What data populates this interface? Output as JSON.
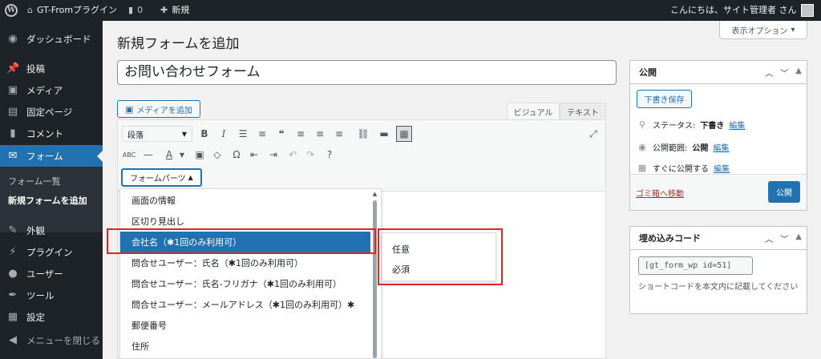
{
  "adminbar": {
    "site_name": "GT-Fromプラグイン",
    "comments_count": "0",
    "new_label": "新規",
    "greeting": "こんにちは、サイト管理者 さん"
  },
  "sidebar": {
    "items": [
      {
        "label": "ダッシュボード",
        "icon": "dashboard-icon",
        "glyph": "◉"
      },
      {
        "label": "投稿",
        "icon": "pin-icon",
        "glyph": "📌"
      },
      {
        "label": "メディア",
        "icon": "media-icon",
        "glyph": "▣"
      },
      {
        "label": "固定ページ",
        "icon": "page-icon",
        "glyph": "▤"
      },
      {
        "label": "コメント",
        "icon": "comment-icon",
        "glyph": "▮"
      },
      {
        "label": "フォーム",
        "icon": "mail-icon",
        "glyph": "✉"
      }
    ],
    "submenu": [
      "フォーム一覧",
      "新規フォームを追加"
    ],
    "items_lower": [
      {
        "label": "外観",
        "icon": "brush-icon",
        "glyph": "✎"
      },
      {
        "label": "プラグイン",
        "icon": "plugin-icon",
        "glyph": "⚡"
      },
      {
        "label": "ユーザー",
        "icon": "user-icon",
        "glyph": "●"
      },
      {
        "label": "ツール",
        "icon": "wrench-icon",
        "glyph": "✒"
      },
      {
        "label": "設定",
        "icon": "settings-icon",
        "glyph": "▦"
      },
      {
        "label": "メニューを閉じる",
        "icon": "collapse-icon",
        "glyph": "◀"
      }
    ]
  },
  "main": {
    "page_title": "新規フォームを追加",
    "screen_options": "表示オプション",
    "title_value": "お問い合わせフォーム",
    "add_media": "メディアを追加",
    "tabs": [
      "ビジュアル",
      "テキスト"
    ]
  },
  "toolbar": {
    "format_select": "段落",
    "form_parts": "フォームパーツ"
  },
  "dropdown": {
    "items": [
      "画面の情報",
      "区切り見出し",
      "会社名（✱1回のみ利用可）",
      "問合せユーザー：氏名（✱1回のみ利用可）",
      "問合せユーザー：氏名-フリガナ（✱1回のみ利用可）",
      "問合せユーザー：メールアドレス（✱1回のみ利用可）✱",
      "郵便番号",
      "住所"
    ],
    "submenu": [
      "任意",
      "必須"
    ]
  },
  "publish_box": {
    "title": "公開",
    "save_draft": "下書き保存",
    "status_label": "ステータス:",
    "status_value": "下書き",
    "visibility_label": "公開範囲:",
    "visibility_value": "公開",
    "schedule": "すぐに公開する",
    "edit": "編集",
    "trash": "ゴミ箱へ移動",
    "publish": "公開"
  },
  "embed_box": {
    "title": "埋め込みコード",
    "code": "[gt_form_wp id=51]",
    "note": "ショートコードを本文内に記載してください"
  },
  "colors": {
    "accent": "#2271b1",
    "dark": "#1d2327",
    "highlight": "#e02424"
  }
}
